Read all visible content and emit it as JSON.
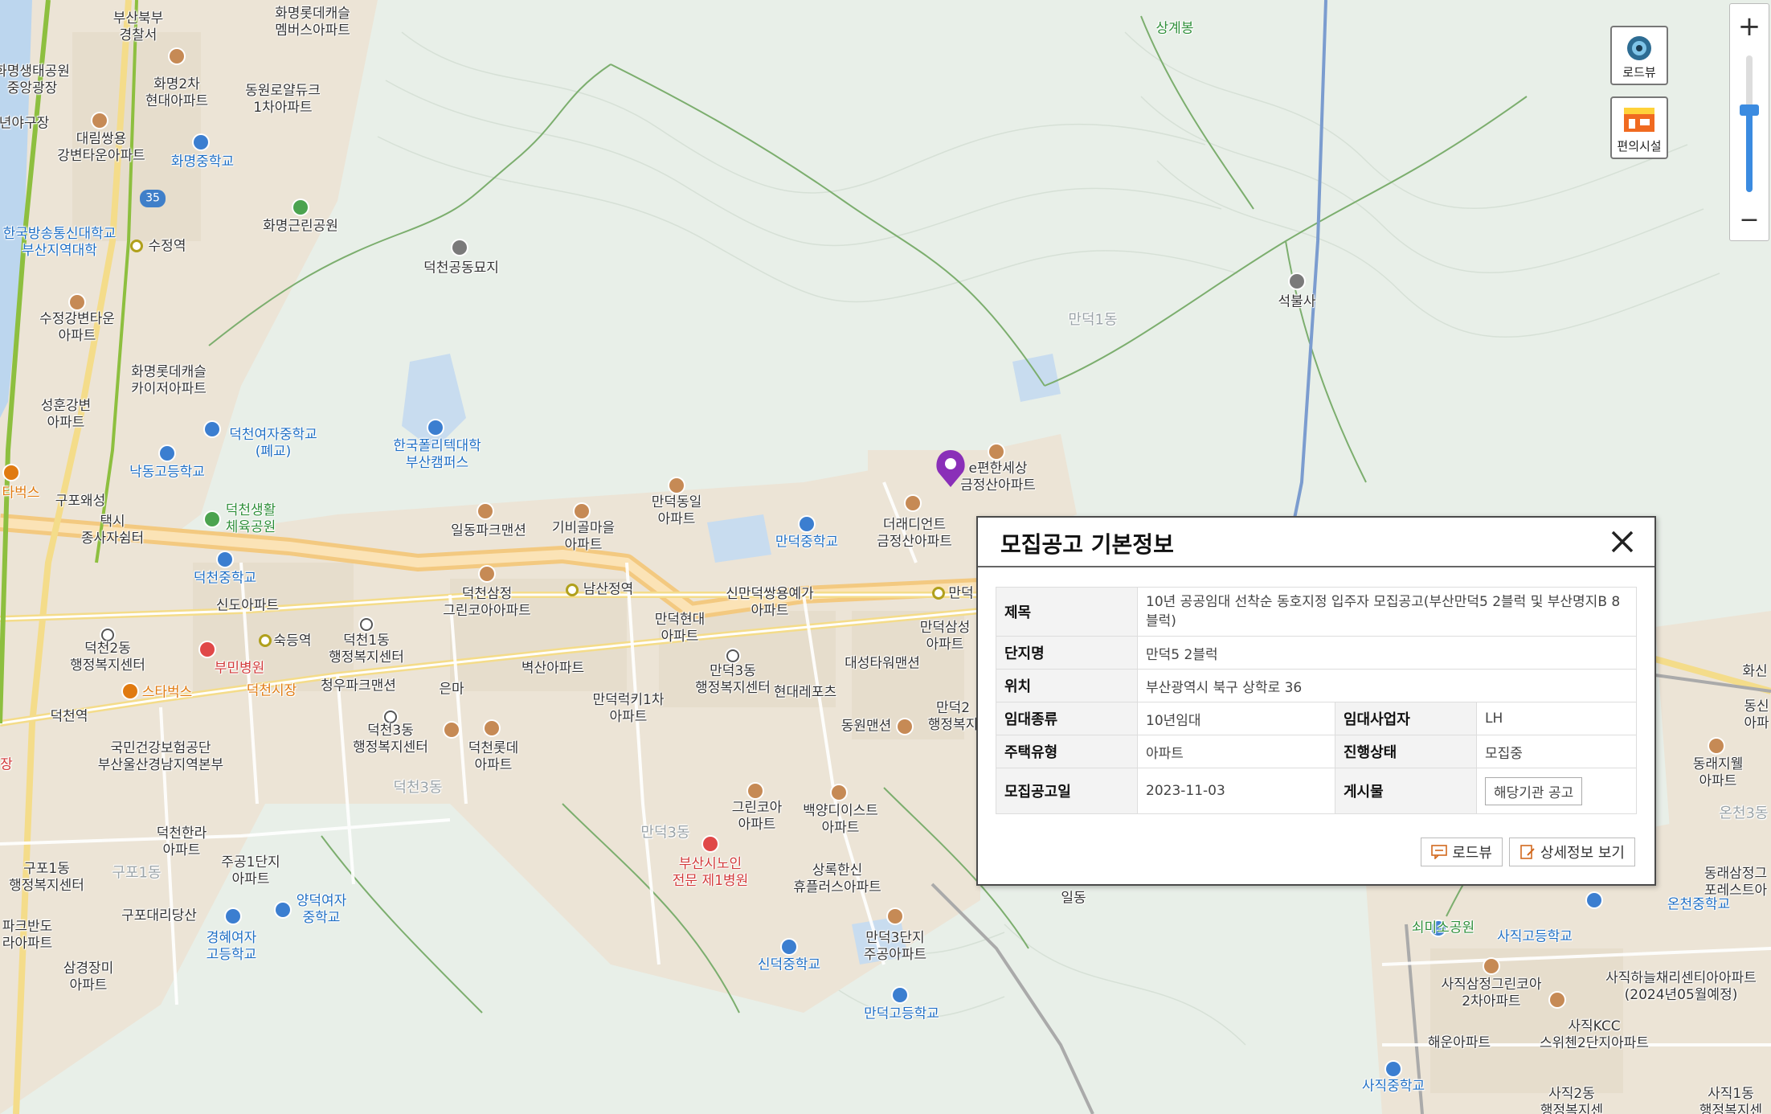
{
  "map": {
    "labels": [
      {
        "t": "부산북부\n경찰서",
        "c": ""
      },
      {
        "t": "화명롯데캐슬\n멤버스아파트",
        "c": ""
      },
      {
        "t": "상계봉",
        "c": "green"
      },
      {
        "t": "화명생태공원\n중앙광장",
        "c": ""
      },
      {
        "t": "화명2차\n현대아파트",
        "c": ""
      },
      {
        "t": "동원로얄듀크\n1차아파트",
        "c": ""
      },
      {
        "t": "년야구장",
        "c": ""
      },
      {
        "t": "대림쌍용\n강변타운아파트",
        "c": ""
      },
      {
        "t": "화명중학교",
        "c": "blue"
      },
      {
        "t": "화명근린공원",
        "c": ""
      },
      {
        "t": "한국방송통신대학교\n부산지역대학",
        "c": "blue"
      },
      {
        "t": "수정역",
        "c": ""
      },
      {
        "t": "덕천공동묘지",
        "c": ""
      },
      {
        "t": "석불사",
        "c": ""
      },
      {
        "t": "만덕1동",
        "c": "dong"
      },
      {
        "t": "수정강변타운\n아파트",
        "c": ""
      },
      {
        "t": "화명롯데캐슬\n카이저아파트",
        "c": ""
      },
      {
        "t": "성훈강변\n아파트",
        "c": ""
      },
      {
        "t": "덕천여자중학교\n(폐교)",
        "c": "blue"
      },
      {
        "t": "한국폴리텍대학\n부산캠퍼스",
        "c": "blue"
      },
      {
        "t": "낙동고등학교",
        "c": "blue"
      },
      {
        "t": "e편한세상\n금정산아파트",
        "c": ""
      },
      {
        "t": "타벅스",
        "c": "orange"
      },
      {
        "t": "구포왜성",
        "c": ""
      },
      {
        "t": "덕천생활\n체육공원",
        "c": "green"
      },
      {
        "t": "만덕동일\n아파트",
        "c": ""
      },
      {
        "t": "더래디언트\n금정산아파트",
        "c": ""
      },
      {
        "t": "택시\n종사자쉼터",
        "c": ""
      },
      {
        "t": "일동파크맨션",
        "c": ""
      },
      {
        "t": "기비골마을\n아파트",
        "c": ""
      },
      {
        "t": "만덕중학교",
        "c": "blue"
      },
      {
        "t": "덕천중학교",
        "c": "blue"
      },
      {
        "t": "덕천삼정\n그린코아아파트",
        "c": ""
      },
      {
        "t": "남산정역",
        "c": ""
      },
      {
        "t": "신만덕쌍용예가\n아파트",
        "c": ""
      },
      {
        "t": "만덕",
        "c": ""
      },
      {
        "t": "신도아파트",
        "c": ""
      },
      {
        "t": "숙등역",
        "c": ""
      },
      {
        "t": "덕천1동\n행정복지센터",
        "c": ""
      },
      {
        "t": "만덕현대\n아파트",
        "c": ""
      },
      {
        "t": "만덕삼성\n아파트",
        "c": ""
      },
      {
        "t": "덕천2동\n행정복지센터",
        "c": ""
      },
      {
        "t": "부민병원",
        "c": "red"
      },
      {
        "t": "벽산아파트",
        "c": ""
      },
      {
        "t": "만덕3동\n행정복지센터",
        "c": ""
      },
      {
        "t": "대성타워맨션",
        "c": ""
      },
      {
        "t": "스타벅스",
        "c": "orange"
      },
      {
        "t": "덕천시장",
        "c": "orange"
      },
      {
        "t": "청우파크맨션",
        "c": ""
      },
      {
        "t": "은마",
        "c": ""
      },
      {
        "t": "만덕럭키1차\n아파트",
        "c": ""
      },
      {
        "t": "현대레포츠",
        "c": ""
      },
      {
        "t": "만덕2\n행정복지",
        "c": ""
      },
      {
        "t": "덕천역",
        "c": ""
      },
      {
        "t": "덕천3동\n행정복지센터",
        "c": ""
      },
      {
        "t": "동원맨션",
        "c": ""
      },
      {
        "t": "국민건강보험공단\n부산울산경남지역본부",
        "c": ""
      },
      {
        "t": "덕천롯데\n아파트",
        "c": ""
      },
      {
        "t": "덕천3동",
        "c": "dong"
      },
      {
        "t": "그린코아\n아파트",
        "c": ""
      },
      {
        "t": "백양디이스트\n아파트",
        "c": ""
      },
      {
        "t": "덕천한라\n아파트",
        "c": ""
      },
      {
        "t": "만덕3동",
        "c": "dong"
      },
      {
        "t": "부산시노인\n전문 제1병원",
        "c": "red"
      },
      {
        "t": "구포1동\n행정복지센터",
        "c": ""
      },
      {
        "t": "구포1동",
        "c": "dong"
      },
      {
        "t": "주공1단지\n아파트",
        "c": ""
      },
      {
        "t": "상록한신\n휴플러스아파트",
        "c": ""
      },
      {
        "t": "양덕여자\n중학교",
        "c": "blue"
      },
      {
        "t": "구포대리당산",
        "c": ""
      },
      {
        "t": "경혜여자\n고등학교",
        "c": "blue"
      },
      {
        "t": "만덕3단지\n주공아파트",
        "c": ""
      },
      {
        "t": "삼경장미\n아파트",
        "c": ""
      },
      {
        "t": "신덕중학교",
        "c": "blue"
      },
      {
        "t": "만덕고등학교",
        "c": "blue"
      },
      {
        "t": "파크반도\n라아파트",
        "c": ""
      },
      {
        "t": "일동",
        "c": ""
      },
      {
        "t": "쇠미소공원",
        "c": "green"
      },
      {
        "t": "사직고등학교",
        "c": "blue"
      },
      {
        "t": "온천중학교",
        "c": "blue"
      },
      {
        "t": "사직삼정그린코아\n2차아파트",
        "c": ""
      },
      {
        "t": "사직하늘채리센티아아파트\n(2024년05월예정)",
        "c": ""
      },
      {
        "t": "사직KCC\n스위첸2단지아파트",
        "c": ""
      },
      {
        "t": "해운아파트",
        "c": ""
      },
      {
        "t": "사직중학교",
        "c": "blue"
      },
      {
        "t": "사직2동\n행정복지센",
        "c": ""
      },
      {
        "t": "사직1동\n행정복지센",
        "c": ""
      },
      {
        "t": "동래삼정그\n포레스트아",
        "c": ""
      },
      {
        "t": "동래지웰\n아파트",
        "c": ""
      },
      {
        "t": "온천3동",
        "c": "dong"
      },
      {
        "t": "화신",
        "c": ""
      },
      {
        "t": "동신\n아파",
        "c": ""
      },
      {
        "t": "장",
        "c": "red"
      }
    ],
    "road_badge": "35"
  },
  "controls": {
    "roadview_label": "로드뷰",
    "facility_label": "편의시설",
    "zoom_in": "+",
    "zoom_out": "−",
    "zoom_level": 0.6
  },
  "popup": {
    "title": "모집공고 기본정보",
    "rows": {
      "title_label": "제목",
      "title_value": "10년 공공임대 선착순 동호지정 입주자 모집공고(부산만덕5 2블럭 및 부산명지B 8블럭)",
      "complex_label": "단지명",
      "complex_value": "만덕5 2블럭",
      "location_label": "위치",
      "location_value": "부산광역시 북구 상학로 36",
      "rent_type_label": "임대종류",
      "rent_type_value": "10년임대",
      "operator_label": "임대사업자",
      "operator_value": "LH",
      "housing_type_label": "주택유형",
      "housing_type_value": "아파트",
      "status_label": "진행상태",
      "status_value": "모집중",
      "date_label": "모집공고일",
      "date_value": "2023-11-03",
      "notice_label": "게시물",
      "notice_button": "해당기관 공고"
    },
    "footer": {
      "roadview_button": "로드뷰",
      "detail_button": "상세정보 보기"
    }
  }
}
